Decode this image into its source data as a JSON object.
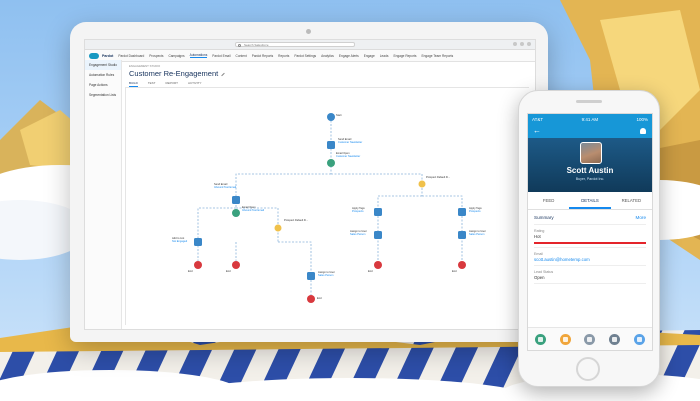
{
  "browser": {
    "search_placeholder": "Search Salesforce"
  },
  "app": {
    "name": "Pardot",
    "nav": [
      "Pardot Dashboard",
      "Prospects",
      "Campaigns",
      "Automations",
      "Pardot Email",
      "Content",
      "Pardot Reports",
      "Reports",
      "Pardot Settings",
      "Analytics",
      "Engage Alerts",
      "Engage",
      "Leads",
      "Engage Reports",
      "Engage Team Reports"
    ]
  },
  "sidebar": {
    "items": [
      "Engagement Studio",
      "Automation Rules",
      "Page Actions",
      "Segmentation Lists"
    ]
  },
  "page": {
    "breadcrumb": "ENGAGEMENT STUDIO",
    "title": "Customer Re-Engagement",
    "tabs": [
      "BUILD",
      "TEST",
      "REPORT",
      "ACTIVITY"
    ]
  },
  "flow": {
    "start": "Start",
    "send_email": {
      "title": "Send Email",
      "sub": "Customer Newsletter"
    },
    "email_open": {
      "title": "Email Open",
      "sub": "Customer Newsletter"
    },
    "left_send_email": {
      "title": "Send Email",
      "sub": "Inbound Test Email"
    },
    "left_email_open": {
      "title": "Email Open",
      "sub": "Inbound Test Email"
    },
    "prospect_default_left": "Prospect Default Fi...",
    "prospect_default_right": "Prospect Default Fi...",
    "add_to_list": {
      "title": "Add to List",
      "sub": "Not Engaged"
    },
    "assign_user_left": {
      "title": "Assign to User",
      "sub": "Sales Person"
    },
    "assign_user_mid": {
      "title": "Assign to User",
      "sub": "Sales Person"
    },
    "assign_user_right": {
      "title": "Assign to User",
      "sub": "Sales Person"
    },
    "apply_tags_a": {
      "title": "Apply Tags",
      "sub": "Prospects"
    },
    "apply_tags_b": {
      "title": "Apply Tags",
      "sub": "Prospects"
    },
    "end_label": "End"
  },
  "phone": {
    "status": {
      "carrier": "AT&T",
      "time": "9:41 AM",
      "battery": "100%"
    },
    "contact": {
      "name": "Scott Austin",
      "role": "Buyer, Pardot Inc."
    },
    "tabs": [
      "FEED",
      "DETAILS",
      "RELATED"
    ],
    "summary": {
      "label": "Summary",
      "more": "More"
    },
    "rating": {
      "label": "Rating",
      "value": "Hot"
    },
    "email": {
      "label": "Email",
      "value": "scott.austin@hometemp.com"
    },
    "lead_status": {
      "label": "Lead Status",
      "value": "Open"
    }
  },
  "colors": {
    "brand_blue": "#1797d7",
    "flow_blue": "#3a87c8",
    "flow_green": "#3aa17e",
    "flow_red": "#d8393e",
    "flow_yellow": "#f0c14b"
  }
}
